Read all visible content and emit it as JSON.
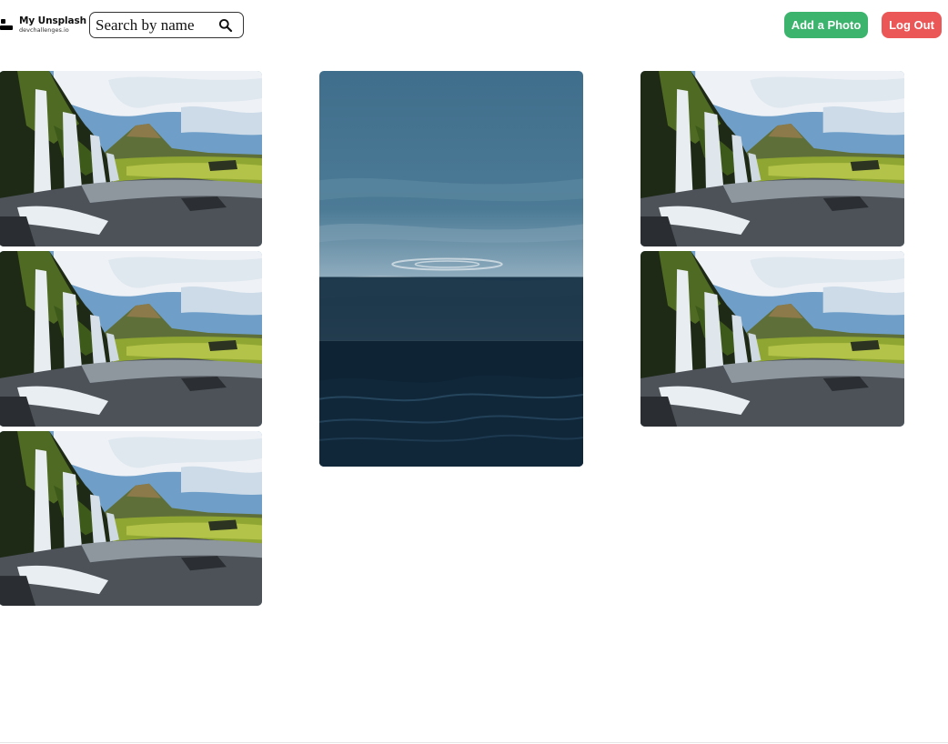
{
  "header": {
    "logo_title": "My Unsplash",
    "logo_subtitle": "devchallenges.io",
    "search_placeholder": "Search by name",
    "add_button_label": "Add a Photo",
    "logout_button_label": "Log Out"
  },
  "icons": {
    "search": "search-icon",
    "logo": "logo-icon"
  },
  "colors": {
    "add_button": "#3db46d",
    "logout_button": "#eb5757",
    "text": "#111111"
  },
  "gallery": {
    "columns": [
      {
        "photos": [
          "waterfall",
          "waterfall",
          "waterfall"
        ]
      },
      {
        "photos": [
          "ocean"
        ]
      },
      {
        "photos": [
          "waterfall",
          "waterfall"
        ]
      }
    ]
  }
}
